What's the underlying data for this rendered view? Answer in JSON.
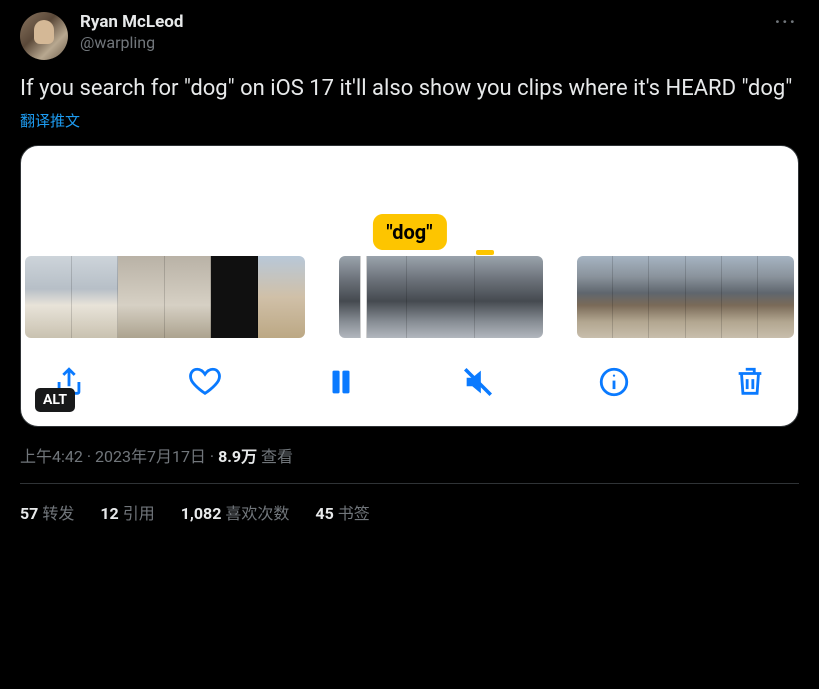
{
  "author": {
    "display_name": "Ryan McLeod",
    "handle": "@warpling"
  },
  "tweet_text": "If you search for \"dog\" on iOS 17 it'll also show you clips where it's HEARD \"dog\"",
  "translate_label": "翻译推文",
  "media": {
    "badge_text": "\"dog\"",
    "alt_label": "ALT"
  },
  "meta": {
    "time": "上午4:42",
    "date": "2023年7月17日",
    "views_number": "8.9万",
    "views_label": "查看",
    "separator": " · "
  },
  "stats": {
    "retweets_num": "57",
    "retweets_label": "转发",
    "quotes_num": "12",
    "quotes_label": "引用",
    "likes_num": "1,082",
    "likes_label": "喜欢次数",
    "bookmarks_num": "45",
    "bookmarks_label": "书签"
  }
}
